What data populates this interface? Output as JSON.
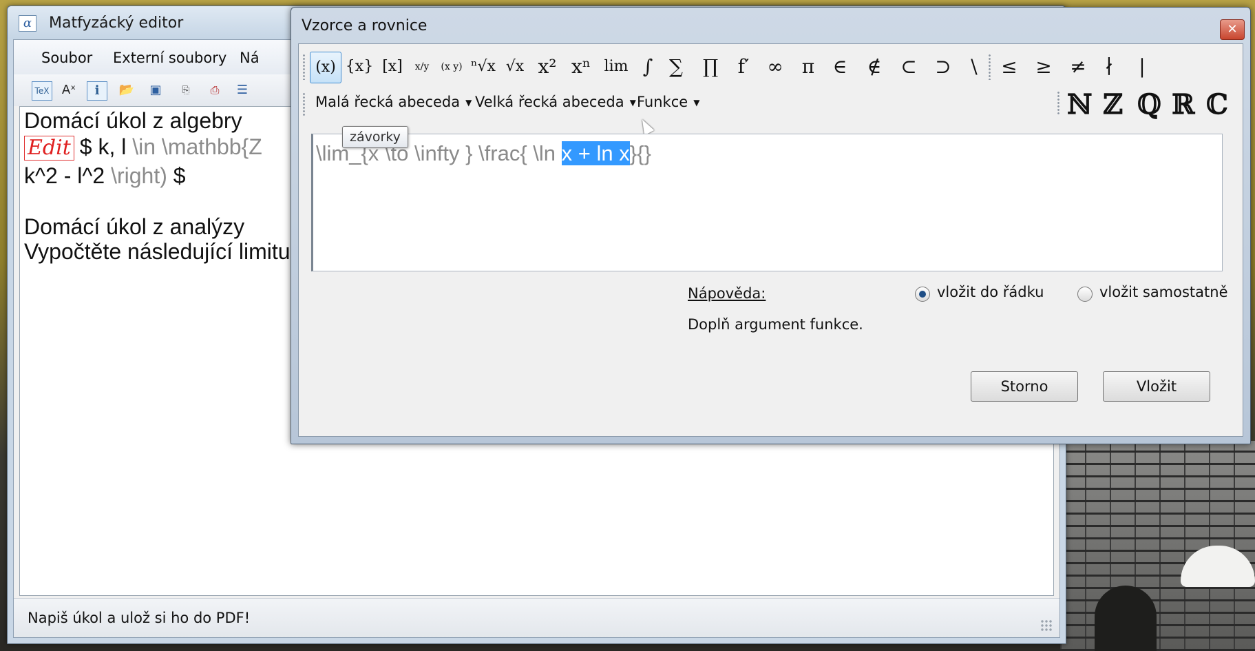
{
  "main_window": {
    "title": "Matfyzácký editor",
    "app_icon": "α",
    "menu": [
      "Soubor",
      "Externí soubory",
      "Ná"
    ],
    "toolbar_icons": [
      "tex-icon",
      "superscript-icon",
      "info-icon",
      "open-folder-icon",
      "save-icon",
      "export-icon",
      "pdf-icon",
      "list-icon"
    ],
    "document": {
      "line1": "Domácí úkol z algebry",
      "edit_badge": "Edit",
      "line2_a": "$ k, l",
      "line2_b": "\\in  \\mathbb{Z",
      "line3_a": "k^2 - l^2",
      "line3_b": "\\right)",
      "line3_c": "$",
      "line4": "Domácí úkol z analýzy",
      "line5": "Vypočtěte následující limitu"
    },
    "status": "Napiš úkol a ulož si ho do PDF!"
  },
  "dialog": {
    "title": "Vzorce a rovnice",
    "close_glyph": "✕",
    "symbols": [
      "(x)",
      "{x}",
      "[x]",
      "x/y",
      "(x y)",
      "ⁿ√x",
      "√x",
      "x²",
      "xⁿ",
      "lim",
      "∫",
      "∑",
      "∏",
      "f′",
      "∞",
      "π",
      "∈",
      "∉",
      "⊂",
      "⊃",
      "\\",
      "≤",
      "≥",
      "≠",
      "∤",
      "|"
    ],
    "dropdowns": [
      "Malá řecká abeceda",
      "Velká řecká abeceda",
      "Funkce"
    ],
    "dropdown_arrow": "▼",
    "sets": [
      "ℕ",
      "ℤ",
      "ℚ",
      "ℝ",
      "ℂ"
    ],
    "tooltip": "závorky",
    "formula_before": "\\lim_{x \\to  \\infty } \\frac{ \\ln ",
    "formula_selected": "x + ln x",
    "formula_after": "}{}",
    "help_label": "Nápověda:",
    "help_text": "Doplň argument funkce.",
    "radio_inline": "vložit do řádku",
    "radio_standalone": "vložit samostatně",
    "cancel": "Storno",
    "insert": "Vložit"
  }
}
